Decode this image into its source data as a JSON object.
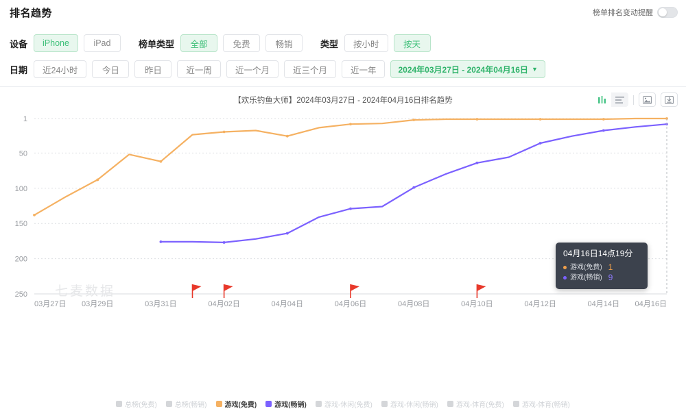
{
  "header": {
    "title": "排名趋势",
    "alert_label": "榜单排名变动提醒",
    "alert_enabled": false
  },
  "filters": {
    "device": {
      "label": "设备",
      "options": [
        {
          "label": "iPhone",
          "active": true
        },
        {
          "label": "iPad",
          "active": false
        }
      ]
    },
    "list_type": {
      "label": "榜单类型",
      "options": [
        {
          "label": "全部",
          "active": true
        },
        {
          "label": "免费",
          "active": false
        },
        {
          "label": "畅销",
          "active": false
        }
      ]
    },
    "granularity": {
      "label": "类型",
      "options": [
        {
          "label": "按小时",
          "active": false
        },
        {
          "label": "按天",
          "active": true
        }
      ]
    },
    "date": {
      "label": "日期",
      "options": [
        {
          "label": "近24小时",
          "active": false
        },
        {
          "label": "今日",
          "active": false
        },
        {
          "label": "昨日",
          "active": false
        },
        {
          "label": "近一周",
          "active": false
        },
        {
          "label": "近一个月",
          "active": false
        },
        {
          "label": "近三个月",
          "active": false
        },
        {
          "label": "近一年",
          "active": false
        }
      ],
      "range_label": "2024年03月27日 - 2024年04月16日",
      "range_caret": "▼"
    }
  },
  "chart_tools": {
    "bar_view_icon": "bar-chart-icon",
    "list_view_icon": "list-view-icon",
    "image_icon": "image-export-icon",
    "download_icon": "download-icon",
    "bar_view_active": true
  },
  "tooltip": {
    "title": "04月16日14点19分",
    "rows": [
      {
        "name": "游戏(免费)",
        "value": "1",
        "color": "#f0a04b"
      },
      {
        "name": "游戏(畅销)",
        "value": "9",
        "color": "#7b61ff"
      }
    ]
  },
  "watermark": "七麦数据",
  "legend": [
    {
      "label": "总榜(免费)",
      "color": "#c9cbcf",
      "active": false
    },
    {
      "label": "总榜(畅销)",
      "color": "#c9cbcf",
      "active": false
    },
    {
      "label": "游戏(免费)",
      "color": "#f5b162",
      "active": true
    },
    {
      "label": "游戏(畅销)",
      "color": "#7b61ff",
      "active": true
    },
    {
      "label": "游戏-休闲(免费)",
      "color": "#c9cbcf",
      "active": false
    },
    {
      "label": "游戏-休闲(畅销)",
      "color": "#c9cbcf",
      "active": false
    },
    {
      "label": "游戏-体育(免费)",
      "color": "#c9cbcf",
      "active": false
    },
    {
      "label": "游戏-体育(畅销)",
      "color": "#c9cbcf",
      "active": false
    }
  ],
  "chart_data": {
    "type": "line",
    "title": "【欢乐钓鱼大师】2024年03月27日 - 2024年04月16日排名趋势",
    "xlabel": "",
    "ylabel": "",
    "grid": true,
    "y_inverted": true,
    "ylim": [
      1,
      250
    ],
    "yticks": [
      1,
      50,
      100,
      150,
      200,
      250
    ],
    "ytick_labels": [
      "1",
      "50",
      "100",
      "150",
      "200",
      "250"
    ],
    "x": [
      "03月27日",
      "03月28日",
      "03月29日",
      "03月30日",
      "03月31日",
      "04月01日",
      "04月02日",
      "04月03日",
      "04月04日",
      "04月05日",
      "04月06日",
      "04月07日",
      "04月08日",
      "04月09日",
      "04月10日",
      "04月11日",
      "04月12日",
      "04月13日",
      "04月14日",
      "04月15日",
      "04月16日"
    ],
    "xtick_labels": [
      "03月27日",
      "03月29日",
      "03月31日",
      "04月02日",
      "04月04日",
      "04月06日",
      "04月08日",
      "04月10日",
      "04月12日",
      "04月14日",
      "04月16日"
    ],
    "legend_position": "bottom",
    "series": [
      {
        "name": "游戏(免费)",
        "color": "#f5b162",
        "values": [
          138,
          112,
          88,
          52,
          62,
          24,
          20,
          18,
          26,
          14,
          9,
          8,
          3,
          2,
          2,
          2,
          2,
          2,
          2,
          1,
          1
        ]
      },
      {
        "name": "游戏(畅销)",
        "color": "#7b61ff",
        "values": [
          null,
          null,
          null,
          null,
          176,
          176,
          177,
          172,
          164,
          141,
          129,
          126,
          99,
          80,
          64,
          56,
          36,
          26,
          18,
          13,
          9
        ]
      }
    ],
    "markers": {
      "type": "flag",
      "color": "#e8392b",
      "dates": [
        "04月01日",
        "04月02日",
        "04月06日",
        "04月10日"
      ]
    }
  }
}
